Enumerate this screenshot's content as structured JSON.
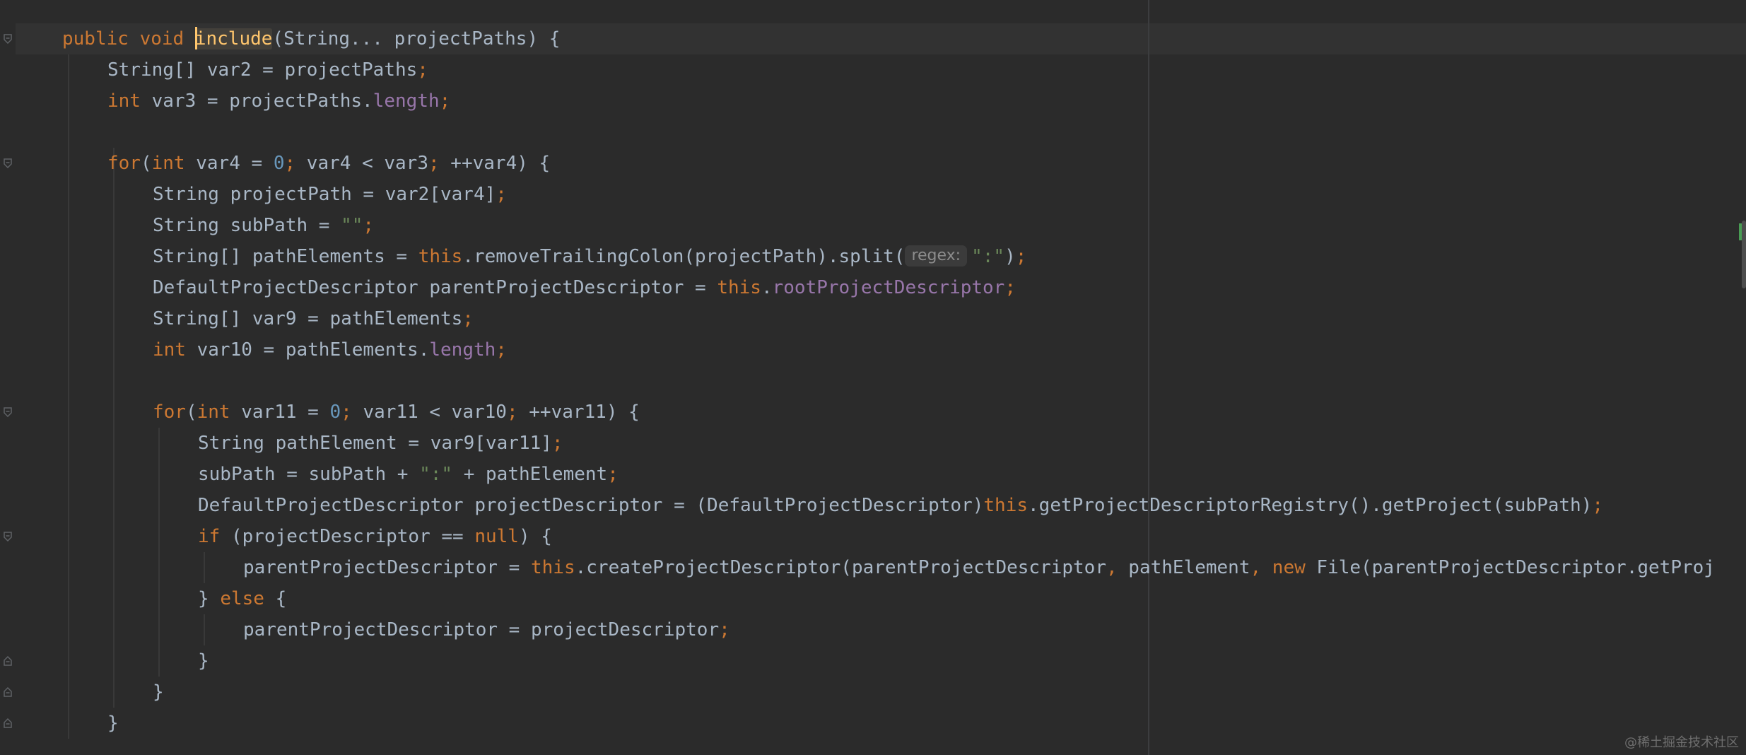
{
  "editor": {
    "colors": {
      "background": "#2b2b2b",
      "keyword": "#cc7832",
      "method": "#ffc66d",
      "number": "#6897bb",
      "string": "#6a8759",
      "field": "#9876aa",
      "text": "#a9b7c6"
    },
    "lines": [
      {
        "segments": [
          {
            "t": "kw",
            "v": "public void "
          },
          {
            "t": "fn",
            "v": "include"
          },
          {
            "t": "p",
            "v": "(String... projectPaths) {"
          }
        ]
      },
      {
        "segments": [
          {
            "t": "p",
            "v": "String[] var2 = projectPaths"
          },
          {
            "t": "kw",
            "v": ";"
          }
        ]
      },
      {
        "segments": [
          {
            "t": "kw",
            "v": "int "
          },
          {
            "t": "p",
            "v": "var3 = projectPaths."
          },
          {
            "t": "fld",
            "v": "length"
          },
          {
            "t": "kw",
            "v": ";"
          }
        ]
      },
      {
        "segments": []
      },
      {
        "segments": [
          {
            "t": "kw",
            "v": "for"
          },
          {
            "t": "p",
            "v": "("
          },
          {
            "t": "kw",
            "v": "int "
          },
          {
            "t": "p",
            "v": "var4 = "
          },
          {
            "t": "num",
            "v": "0"
          },
          {
            "t": "kw",
            "v": "; "
          },
          {
            "t": "p",
            "v": "var4 < var3"
          },
          {
            "t": "kw",
            "v": "; "
          },
          {
            "t": "p",
            "v": "++var4) {"
          }
        ]
      },
      {
        "segments": [
          {
            "t": "p",
            "v": "String projectPath = var2[var4]"
          },
          {
            "t": "kw",
            "v": ";"
          }
        ]
      },
      {
        "segments": [
          {
            "t": "p",
            "v": "String subPath = "
          },
          {
            "t": "str",
            "v": "\"\""
          },
          {
            "t": "kw",
            "v": ";"
          }
        ]
      },
      {
        "segments": [
          {
            "t": "p",
            "v": "String[] pathElements = "
          },
          {
            "t": "kw",
            "v": "this"
          },
          {
            "t": "p",
            "v": ".removeTrailingColon(projectPath).split("
          },
          {
            "t": "hint",
            "v": "regex:"
          },
          {
            "t": "str",
            "v": "\":\""
          },
          {
            "t": "p",
            "v": ")"
          },
          {
            "t": "kw",
            "v": ";"
          }
        ]
      },
      {
        "segments": [
          {
            "t": "p",
            "v": "DefaultProjectDescriptor parentProjectDescriptor = "
          },
          {
            "t": "kw",
            "v": "this"
          },
          {
            "t": "p",
            "v": "."
          },
          {
            "t": "fld",
            "v": "rootProjectDescriptor"
          },
          {
            "t": "kw",
            "v": ";"
          }
        ]
      },
      {
        "segments": [
          {
            "t": "p",
            "v": "String[] var9 = pathElements"
          },
          {
            "t": "kw",
            "v": ";"
          }
        ]
      },
      {
        "segments": [
          {
            "t": "kw",
            "v": "int "
          },
          {
            "t": "p",
            "v": "var10 = pathElements."
          },
          {
            "t": "fld",
            "v": "length"
          },
          {
            "t": "kw",
            "v": ";"
          }
        ]
      },
      {
        "segments": []
      },
      {
        "segments": [
          {
            "t": "kw",
            "v": "for"
          },
          {
            "t": "p",
            "v": "("
          },
          {
            "t": "kw",
            "v": "int "
          },
          {
            "t": "p",
            "v": "var11 = "
          },
          {
            "t": "num",
            "v": "0"
          },
          {
            "t": "kw",
            "v": "; "
          },
          {
            "t": "p",
            "v": "var11 < var10"
          },
          {
            "t": "kw",
            "v": "; "
          },
          {
            "t": "p",
            "v": "++var11) {"
          }
        ]
      },
      {
        "segments": [
          {
            "t": "p",
            "v": "String pathElement = var9[var11]"
          },
          {
            "t": "kw",
            "v": ";"
          }
        ]
      },
      {
        "segments": [
          {
            "t": "p",
            "v": "subPath = subPath + "
          },
          {
            "t": "str",
            "v": "\":\""
          },
          {
            "t": "p",
            "v": " + pathElement"
          },
          {
            "t": "kw",
            "v": ";"
          }
        ]
      },
      {
        "segments": [
          {
            "t": "p",
            "v": "DefaultProjectDescriptor projectDescriptor = (DefaultProjectDescriptor)"
          },
          {
            "t": "kw",
            "v": "this"
          },
          {
            "t": "p",
            "v": ".getProjectDescriptorRegistry().getProject(subPath)"
          },
          {
            "t": "kw",
            "v": ";"
          }
        ]
      },
      {
        "segments": [
          {
            "t": "kw",
            "v": "if "
          },
          {
            "t": "p",
            "v": "(projectDescriptor == "
          },
          {
            "t": "kw",
            "v": "null"
          },
          {
            "t": "p",
            "v": ") {"
          }
        ]
      },
      {
        "segments": [
          {
            "t": "p",
            "v": "parentProjectDescriptor = "
          },
          {
            "t": "kw",
            "v": "this"
          },
          {
            "t": "p",
            "v": ".createProjectDescriptor(parentProjectDescriptor"
          },
          {
            "t": "kw",
            "v": ", "
          },
          {
            "t": "p",
            "v": "pathElement"
          },
          {
            "t": "kw",
            "v": ", new "
          },
          {
            "t": "p",
            "v": "File(parentProjectDescriptor.getProj"
          }
        ]
      },
      {
        "segments": [
          {
            "t": "p",
            "v": "} "
          },
          {
            "t": "kw",
            "v": "else "
          },
          {
            "t": "p",
            "v": "{"
          }
        ]
      },
      {
        "segments": [
          {
            "t": "p",
            "v": "parentProjectDescriptor = projectDescriptor"
          },
          {
            "t": "kw",
            "v": ";"
          }
        ]
      },
      {
        "segments": [
          {
            "t": "p",
            "v": "}"
          }
        ]
      },
      {
        "segments": [
          {
            "t": "p",
            "v": "}"
          }
        ]
      },
      {
        "segments": [
          {
            "t": "p",
            "v": "}"
          }
        ]
      }
    ],
    "inlay_hint": "regex:",
    "watermark": "@稀土掘金技术社区"
  }
}
